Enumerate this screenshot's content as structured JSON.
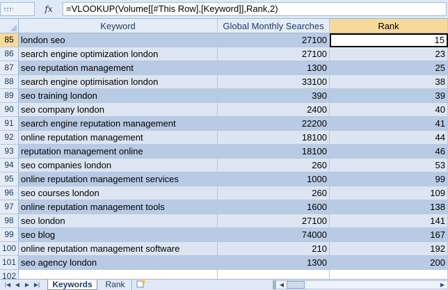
{
  "formula_bar": {
    "fx_label": "fx",
    "formula": "=VLOOKUP(Volume[[#This Row],[Keyword]],Rank,2)"
  },
  "columns": {
    "keyword": "Keyword",
    "searches": "Global Monthly Searches",
    "rank": "Rank"
  },
  "rows": [
    {
      "n": "85",
      "keyword": "london seo",
      "searches": "27100",
      "rank": "15"
    },
    {
      "n": "86",
      "keyword": "search engine optimization london",
      "searches": "27100",
      "rank": "23"
    },
    {
      "n": "87",
      "keyword": "seo reputation management",
      "searches": "1300",
      "rank": "25"
    },
    {
      "n": "88",
      "keyword": "search engine optimisation london",
      "searches": "33100",
      "rank": "38"
    },
    {
      "n": "89",
      "keyword": "seo training london",
      "searches": "390",
      "rank": "39"
    },
    {
      "n": "90",
      "keyword": "seo company london",
      "searches": "2400",
      "rank": "40"
    },
    {
      "n": "91",
      "keyword": "search engine reputation management",
      "searches": "22200",
      "rank": "41"
    },
    {
      "n": "92",
      "keyword": "online reputation management",
      "searches": "18100",
      "rank": "44"
    },
    {
      "n": "93",
      "keyword": "reputation management online",
      "searches": "18100",
      "rank": "46"
    },
    {
      "n": "94",
      "keyword": "seo companies london",
      "searches": "260",
      "rank": "53"
    },
    {
      "n": "95",
      "keyword": "online reputation management services",
      "searches": "1000",
      "rank": "99"
    },
    {
      "n": "96",
      "keyword": "seo courses london",
      "searches": "260",
      "rank": "109"
    },
    {
      "n": "97",
      "keyword": "online reputation management tools",
      "searches": "1600",
      "rank": "138"
    },
    {
      "n": "98",
      "keyword": "seo london",
      "searches": "27100",
      "rank": "141"
    },
    {
      "n": "99",
      "keyword": "seo blog",
      "searches": "74000",
      "rank": "167"
    },
    {
      "n": "100",
      "keyword": "online reputation management software",
      "searches": "210",
      "rank": "192"
    },
    {
      "n": "101",
      "keyword": "seo agency london",
      "searches": "1300",
      "rank": "200"
    },
    {
      "n": "102",
      "keyword": "",
      "searches": "",
      "rank": ""
    }
  ],
  "sheet_tabs": {
    "active": "Keywords",
    "other": "Rank"
  },
  "colors": {
    "header_bg": "#e4ecf7",
    "active_header_bg": "#f9d99a",
    "band_dark": "#b9cbe4",
    "band_light": "#dce6f2"
  }
}
